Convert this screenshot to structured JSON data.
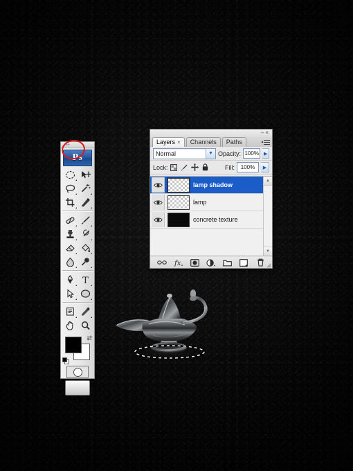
{
  "app": {
    "name": "Adobe Photoshop",
    "logo_text": "Ps"
  },
  "background": {
    "description": "dark concrete texture",
    "color": "#0a0a0a"
  },
  "toolbar": {
    "name": "Tools panel",
    "selected_tool": "elliptical-marquee",
    "highlight": {
      "shape": "ellipse",
      "color": "#e01a1a",
      "target": "elliptical-marquee-tool"
    },
    "tools": [
      {
        "name": "elliptical-marquee-tool",
        "label": "Elliptical Marquee Tool",
        "has_flyout": true
      },
      {
        "name": "move-tool",
        "label": "Move Tool",
        "has_flyout": false
      },
      {
        "name": "lasso-tool",
        "label": "Lasso Tool",
        "has_flyout": true
      },
      {
        "name": "magic-wand-tool",
        "label": "Magic Wand Tool",
        "has_flyout": true
      },
      {
        "name": "crop-tool",
        "label": "Crop Tool",
        "has_flyout": true
      },
      {
        "name": "slice-tool",
        "label": "Slice Tool",
        "has_flyout": true
      },
      {
        "name": "healing-brush-tool",
        "label": "Spot Healing Brush Tool",
        "has_flyout": true
      },
      {
        "name": "brush-tool",
        "label": "Brush Tool",
        "has_flyout": true
      },
      {
        "name": "clone-stamp-tool",
        "label": "Clone Stamp Tool",
        "has_flyout": true
      },
      {
        "name": "history-brush-tool",
        "label": "History Brush Tool",
        "has_flyout": true
      },
      {
        "name": "eraser-tool",
        "label": "Eraser Tool",
        "has_flyout": true
      },
      {
        "name": "paint-bucket-tool",
        "label": "Paint Bucket Tool",
        "has_flyout": true
      },
      {
        "name": "blur-tool",
        "label": "Blur Tool",
        "has_flyout": true
      },
      {
        "name": "dodge-tool",
        "label": "Dodge Tool",
        "has_flyout": true
      },
      {
        "name": "pen-tool",
        "label": "Pen Tool",
        "has_flyout": true
      },
      {
        "name": "type-tool",
        "label": "Horizontal Type Tool",
        "has_flyout": true
      },
      {
        "name": "path-selection-tool",
        "label": "Path Selection Tool",
        "has_flyout": true
      },
      {
        "name": "ellipse-shape-tool",
        "label": "Ellipse Tool",
        "has_flyout": true
      },
      {
        "name": "notes-tool",
        "label": "Notes Tool",
        "has_flyout": true
      },
      {
        "name": "eyedropper-tool",
        "label": "Eyedropper Tool",
        "has_flyout": true
      },
      {
        "name": "hand-tool",
        "label": "Hand Tool",
        "has_flyout": false
      },
      {
        "name": "zoom-tool",
        "label": "Zoom Tool",
        "has_flyout": false
      }
    ],
    "colors": {
      "foreground": "#000000",
      "background": "#ffffff",
      "swap_icon": "swap-colors-icon",
      "default_icon": "default-colors-icon"
    },
    "quick_mask_label": "Edit in Quick Mask Mode",
    "screen_mode_label": "Change Screen Mode"
  },
  "layers_panel": {
    "title_buttons": {
      "minimize": "–",
      "close": "×"
    },
    "panel_menu_icon": "panel-menu-icon",
    "tabs": [
      {
        "label": "Layers",
        "active": true,
        "closable": true
      },
      {
        "label": "Channels",
        "active": false,
        "closable": false
      },
      {
        "label": "Paths",
        "active": false,
        "closable": false
      }
    ],
    "blend_mode": {
      "value": "Normal",
      "chevron": "▼"
    },
    "opacity": {
      "label": "Opacity:",
      "value": "100%",
      "arrow": "▶"
    },
    "fill": {
      "label": "Fill:",
      "value": "100%",
      "arrow": "▶"
    },
    "lock": {
      "label": "Lock:",
      "items": [
        {
          "name": "lock-transparent-pixels-icon",
          "glyph": "transparency"
        },
        {
          "name": "lock-image-pixels-icon",
          "glyph": "brush"
        },
        {
          "name": "lock-position-icon",
          "glyph": "move"
        },
        {
          "name": "lock-all-icon",
          "glyph": "padlock"
        }
      ]
    },
    "layers": [
      {
        "name": "lamp shadow",
        "visible": true,
        "selected": true,
        "thumb": "transparent"
      },
      {
        "name": "lamp",
        "visible": true,
        "selected": false,
        "thumb": "transparent"
      },
      {
        "name": "concrete texture",
        "visible": true,
        "selected": false,
        "thumb": "solid-black"
      }
    ],
    "scrollbar": {
      "up": "▲",
      "down": "▼"
    },
    "footer_buttons": [
      {
        "name": "link-layers-button",
        "label": "Link layers"
      },
      {
        "name": "layer-style-button",
        "label": "fx"
      },
      {
        "name": "layer-mask-button",
        "label": "Add layer mask"
      },
      {
        "name": "adjustment-layer-button",
        "label": "New fill or adjustment layer"
      },
      {
        "name": "new-group-button",
        "label": "Create a new group"
      },
      {
        "name": "new-layer-button",
        "label": "Create a new layer"
      },
      {
        "name": "delete-layer-button",
        "label": "Delete layer"
      }
    ]
  },
  "canvas": {
    "subject": "genie lamp",
    "selection": {
      "type": "elliptical-marquee",
      "style": "marching-ants"
    }
  }
}
